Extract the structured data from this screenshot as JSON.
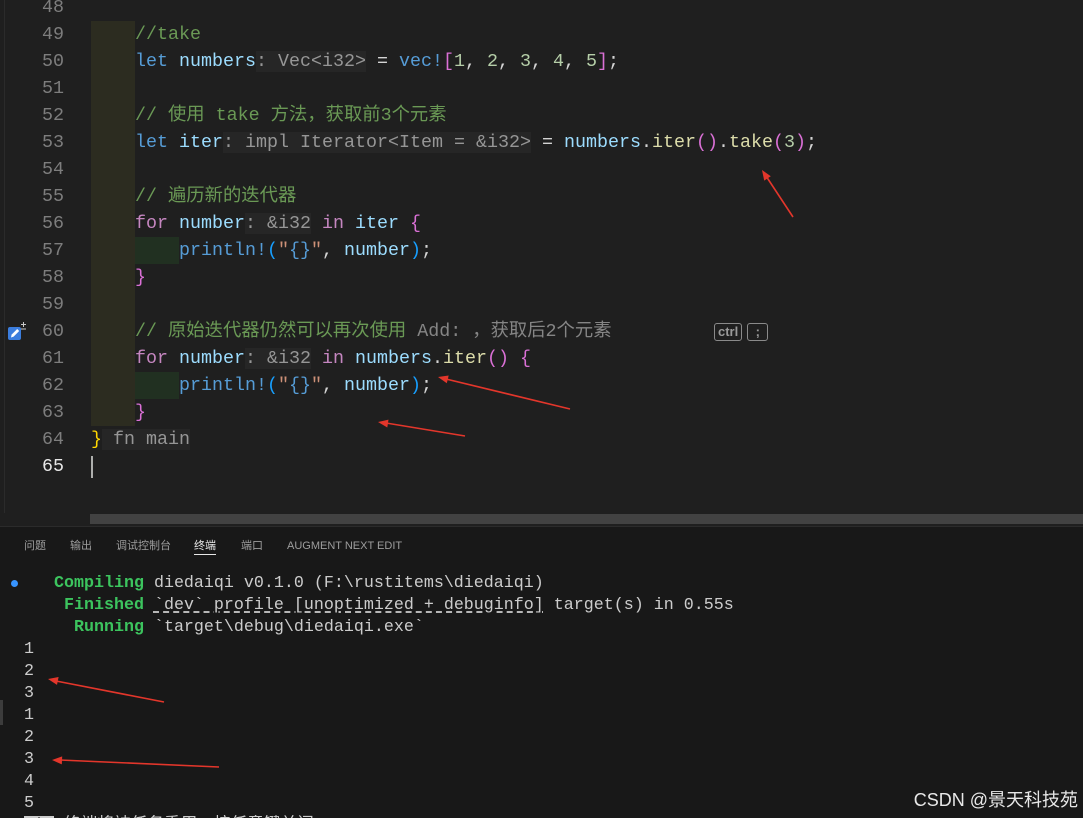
{
  "editor": {
    "current_line": "65",
    "syntax_colors": {
      "kw": "#569cd6",
      "ctrl": "#c586c0",
      "var": "#9cdcfe",
      "cmt": "#6a9955",
      "num": "#b5cea8",
      "mac": "#569cd6",
      "fn": "#dcdcaa",
      "str": "#ce9178",
      "fmt": "#569cd6",
      "op": "#d4d4d4",
      "hint": "#969696",
      "ghost": "#858585",
      "b1": "#ffd700",
      "b2": "#da70d6",
      "b3": "#179fff"
    },
    "indent_guide_colors": [
      "#2c2c20",
      "#213021"
    ],
    "lines": [
      {
        "n": "48",
        "indent": 0,
        "tokens": []
      },
      {
        "n": "49",
        "indent": 1,
        "tokens": [
          {
            "t": "//take",
            "k": "cmt"
          }
        ]
      },
      {
        "n": "50",
        "indent": 1,
        "tokens": [
          {
            "t": "let",
            "k": "kw"
          },
          {
            "t": " numbers",
            "k": "var"
          },
          {
            "t": ": Vec<i32>",
            "k": "hint"
          },
          {
            "t": " = ",
            "k": "op"
          },
          {
            "t": "vec!",
            "k": "mac"
          },
          {
            "t": "[",
            "k": "b2"
          },
          {
            "t": "1",
            "k": "num"
          },
          {
            "t": ", ",
            "k": "op"
          },
          {
            "t": "2",
            "k": "num"
          },
          {
            "t": ", ",
            "k": "op"
          },
          {
            "t": "3",
            "k": "num"
          },
          {
            "t": ", ",
            "k": "op"
          },
          {
            "t": "4",
            "k": "num"
          },
          {
            "t": ", ",
            "k": "op"
          },
          {
            "t": "5",
            "k": "num"
          },
          {
            "t": "]",
            "k": "b2"
          },
          {
            "t": ";",
            "k": "op"
          }
        ]
      },
      {
        "n": "51",
        "indent": 1,
        "tokens": []
      },
      {
        "n": "52",
        "indent": 1,
        "tokens": [
          {
            "t": "// 使用 take 方法，获取前3个元素",
            "k": "cmt"
          }
        ]
      },
      {
        "n": "53",
        "indent": 1,
        "tokens": [
          {
            "t": "let",
            "k": "kw"
          },
          {
            "t": " iter",
            "k": "var"
          },
          {
            "t": ": impl Iterator<Item = &i32>",
            "k": "hint"
          },
          {
            "t": " = ",
            "k": "op"
          },
          {
            "t": "numbers",
            "k": "var"
          },
          {
            "t": ".",
            "k": "op"
          },
          {
            "t": "iter",
            "k": "fn"
          },
          {
            "t": "(",
            "k": "b2"
          },
          {
            "t": ")",
            "k": "b2"
          },
          {
            "t": ".",
            "k": "op"
          },
          {
            "t": "take",
            "k": "fn"
          },
          {
            "t": "(",
            "k": "b2"
          },
          {
            "t": "3",
            "k": "num"
          },
          {
            "t": ")",
            "k": "b2"
          },
          {
            "t": ";",
            "k": "op"
          }
        ]
      },
      {
        "n": "54",
        "indent": 1,
        "tokens": []
      },
      {
        "n": "55",
        "indent": 1,
        "tokens": [
          {
            "t": "// 遍历新的迭代器",
            "k": "cmt"
          }
        ]
      },
      {
        "n": "56",
        "indent": 1,
        "tokens": [
          {
            "t": "for",
            "k": "ctrl"
          },
          {
            "t": " number",
            "k": "var"
          },
          {
            "t": ": &i32",
            "k": "hint"
          },
          {
            "t": " in",
            "k": "ctrl"
          },
          {
            "t": " iter",
            "k": "var"
          },
          {
            "t": " {",
            "k": "b2"
          }
        ]
      },
      {
        "n": "57",
        "indent": 2,
        "tokens": [
          {
            "t": "println!",
            "k": "mac"
          },
          {
            "t": "(",
            "k": "b3"
          },
          {
            "t": "\"",
            "k": "str"
          },
          {
            "t": "{}",
            "k": "fmt"
          },
          {
            "t": "\"",
            "k": "str"
          },
          {
            "t": ", ",
            "k": "op"
          },
          {
            "t": "number",
            "k": "var"
          },
          {
            "t": ")",
            "k": "b3"
          },
          {
            "t": ";",
            "k": "op"
          }
        ]
      },
      {
        "n": "58",
        "indent": 1,
        "tokens": [
          {
            "t": "}",
            "k": "b2"
          }
        ]
      },
      {
        "n": "59",
        "indent": 1,
        "tokens": []
      },
      {
        "n": "60",
        "indent": 1,
        "tokens": [
          {
            "t": "// 原始迭代器仍然可以再次使用",
            "k": "cmt"
          },
          {
            "t": " Add: ，获取后2个元素",
            "k": "ghost"
          }
        ]
      },
      {
        "n": "61",
        "indent": 1,
        "tokens": [
          {
            "t": "for",
            "k": "ctrl"
          },
          {
            "t": " number",
            "k": "var"
          },
          {
            "t": ": &i32",
            "k": "hint"
          },
          {
            "t": " in",
            "k": "ctrl"
          },
          {
            "t": " numbers",
            "k": "var"
          },
          {
            "t": ".",
            "k": "op"
          },
          {
            "t": "iter",
            "k": "fn"
          },
          {
            "t": "(",
            "k": "b2"
          },
          {
            "t": ")",
            "k": "b2"
          },
          {
            "t": " {",
            "k": "b2"
          }
        ]
      },
      {
        "n": "62",
        "indent": 2,
        "tokens": [
          {
            "t": "println!",
            "k": "mac"
          },
          {
            "t": "(",
            "k": "b3"
          },
          {
            "t": "\"",
            "k": "str"
          },
          {
            "t": "{}",
            "k": "fmt"
          },
          {
            "t": "\"",
            "k": "str"
          },
          {
            "t": ", ",
            "k": "op"
          },
          {
            "t": "number",
            "k": "var"
          },
          {
            "t": ")",
            "k": "b3"
          },
          {
            "t": ";",
            "k": "op"
          }
        ]
      },
      {
        "n": "63",
        "indent": 1,
        "tokens": [
          {
            "t": "}",
            "k": "b2"
          }
        ]
      },
      {
        "n": "64",
        "indent": 0,
        "tokens": [
          {
            "t": "}",
            "k": "b1"
          },
          {
            "t": " fn main",
            "k": "hint"
          }
        ]
      },
      {
        "n": "65",
        "indent": 0,
        "tokens": []
      }
    ]
  },
  "next_edit": {
    "icon": "next-edit-icon",
    "keys": [
      "ctrl",
      ";"
    ]
  },
  "panel": {
    "tabs": [
      {
        "label": "问题"
      },
      {
        "label": "输出"
      },
      {
        "label": "调试控制台"
      },
      {
        "label": "终端",
        "active": true
      },
      {
        "label": "端口"
      },
      {
        "label": "AUGMENT NEXT EDIT"
      }
    ]
  },
  "terminal": {
    "colors": {
      "text": "#cccccc",
      "green": "#3cc45e",
      "inverse_bg": "#cccccc",
      "decoration": "#3794ff"
    },
    "decoration_icon": "command-success-dot",
    "lines": [
      [
        {
          "t": "   Compiling",
          "k": "green"
        },
        {
          "t": " diedaiqi v0.1.0 (F:\\rustitems\\diedaiqi)"
        }
      ],
      [
        {
          "t": "    Finished",
          "k": "green"
        },
        {
          "t": " "
        },
        {
          "t": "`dev` profile [unoptimized + debuginfo]",
          "k": "link"
        },
        {
          "t": " target(s) in 0.55s"
        }
      ],
      [
        {
          "t": "     Running",
          "k": "green"
        },
        {
          "t": " `target\\debug\\diedaiqi.exe`"
        }
      ],
      [
        {
          "t": "1"
        }
      ],
      [
        {
          "t": "2"
        }
      ],
      [
        {
          "t": "3"
        }
      ],
      [
        {
          "t": "1"
        }
      ],
      [
        {
          "t": "2"
        }
      ],
      [
        {
          "t": "3"
        }
      ],
      [
        {
          "t": "4"
        }
      ],
      [
        {
          "t": "5"
        }
      ]
    ],
    "footer": [
      {
        "t": " * ",
        "k": "inverse"
      },
      {
        "t": " 终端将被任务重用，按任意键关闭。"
      }
    ]
  },
  "watermark": "CSDN @景天科技苑",
  "annotations": {
    "arrow_color": "#e3362b"
  }
}
